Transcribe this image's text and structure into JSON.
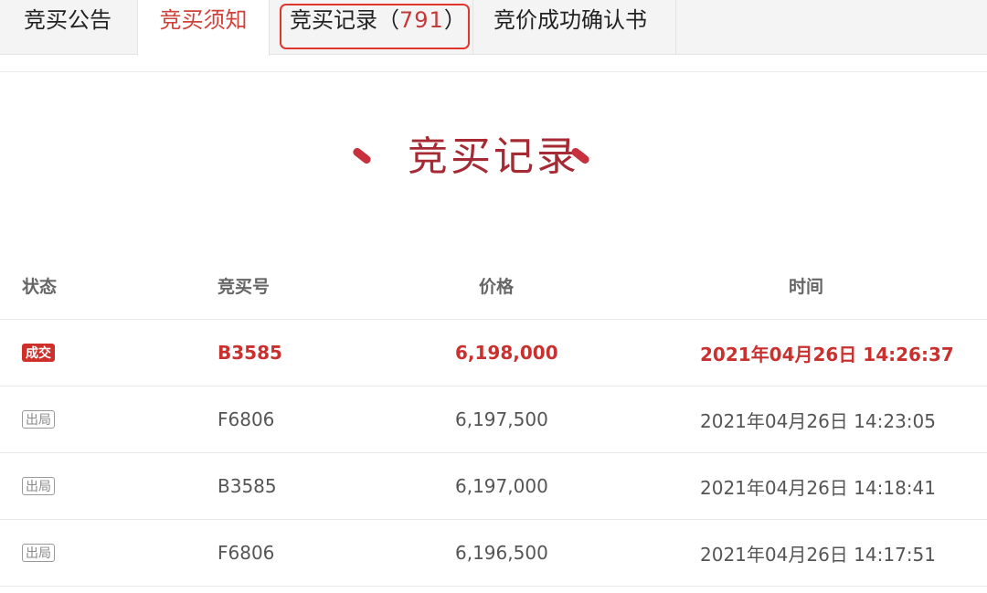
{
  "tabs": {
    "notice": "竞买公告",
    "rules": "竞买须知",
    "records_label": "竞买记录",
    "records_open": "（",
    "records_count": "791",
    "records_close": "）",
    "confirm": "竞价成功确认书"
  },
  "section": {
    "title": "竞买记录"
  },
  "table": {
    "headers": {
      "status": "状态",
      "bidder": "竞买号",
      "price": "价格",
      "time": "时间"
    },
    "rows": [
      {
        "status": "成交",
        "bidder": "B3585",
        "price": "6,198,000",
        "time": "2021年04月26日 14:26:37"
      },
      {
        "status": "出局",
        "bidder": "F6806",
        "price": "6,197,500",
        "time": "2021年04月26日 14:23:05"
      },
      {
        "status": "出局",
        "bidder": "B3585",
        "price": "6,197,000",
        "time": "2021年04月26日 14:18:41"
      },
      {
        "status": "出局",
        "bidder": "F6806",
        "price": "6,196,500",
        "time": "2021年04月26日 14:17:51"
      }
    ]
  },
  "colors": {
    "accent": "#d0413a",
    "title": "#a52a34",
    "win": "#c9312f",
    "highlight_box": "#e0362e"
  }
}
